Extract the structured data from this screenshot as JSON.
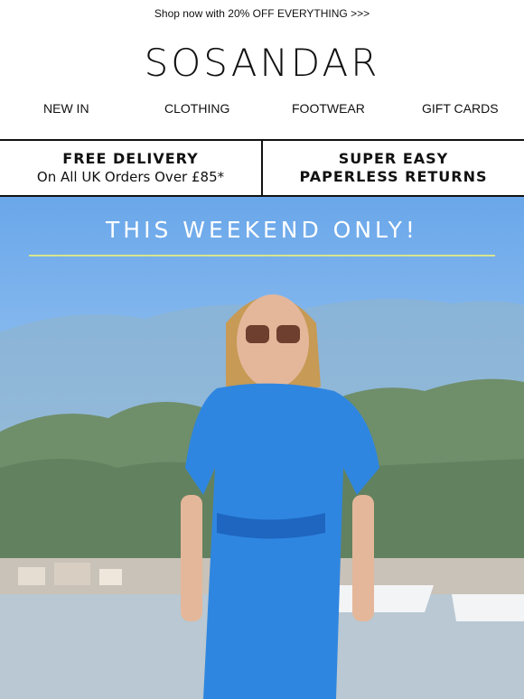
{
  "promo": {
    "text": "Shop now with 20% OFF EVERYTHING >>>"
  },
  "brand": {
    "logo": "SOSANDAR"
  },
  "nav": {
    "items": [
      {
        "label": "NEW IN"
      },
      {
        "label": "CLOTHING"
      },
      {
        "label": "FOOTWEAR"
      },
      {
        "label": "GIFT CARDS"
      }
    ]
  },
  "usp": {
    "left": {
      "title": "FREE DELIVERY",
      "subtitle": "On All UK Orders Over £85*"
    },
    "right": {
      "line1": "SUPER EASY",
      "line2": "PAPERLESS RETURNS"
    }
  },
  "hero": {
    "title": "THIS WEEKEND ONLY!",
    "rule_color": "#d9e58a",
    "image": "woman-in-blue-print-shirt-dress-photo"
  },
  "colors": {
    "text": "#111111",
    "sky": "#7fb3ec",
    "dress": "#2f86e0"
  }
}
